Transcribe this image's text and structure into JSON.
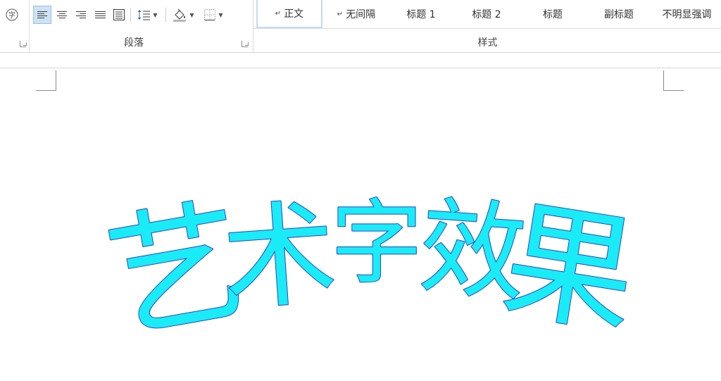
{
  "paragraph_group": {
    "caption": "段落",
    "tools": [
      "circle-char-icon",
      "align-left-icon",
      "align-center-icon",
      "align-right-icon",
      "justify-icon",
      "distributed-icon",
      "line-spacing-icon",
      "shading-icon",
      "borders-icon"
    ]
  },
  "styles_group": {
    "caption": "样式",
    "items": [
      {
        "label": "正文",
        "selected": true,
        "mark": true
      },
      {
        "label": "无间隔",
        "selected": false,
        "mark": true
      },
      {
        "label": "标题 1",
        "selected": false,
        "mark": false
      },
      {
        "label": "标题 2",
        "selected": false,
        "mark": false
      },
      {
        "label": "标题",
        "selected": false,
        "mark": false
      },
      {
        "label": "副标题",
        "selected": false,
        "mark": false
      },
      {
        "label": "不明显强调",
        "selected": false,
        "mark": false
      }
    ]
  },
  "document": {
    "wordart_text": "艺术字效果",
    "wordart_fill": "#19ecf6",
    "wordart_outline": "#2a43c9"
  },
  "colors": {
    "accent_selected": "#cde2f5",
    "gallery_border": "#c6d9ef"
  }
}
